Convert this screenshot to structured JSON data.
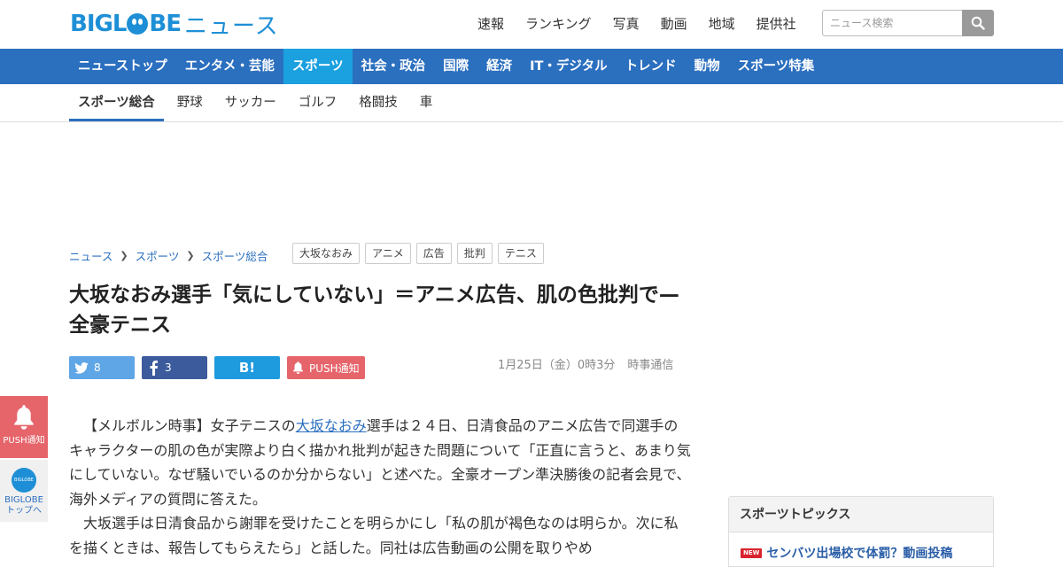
{
  "header": {
    "logo_brand": "BIGL",
    "logo_brand_end": "BE",
    "logo_news": "ニュース",
    "top_links": [
      "速報",
      "ランキング",
      "写真",
      "動画",
      "地域",
      "提供社"
    ],
    "search_placeholder": "ニュース検索"
  },
  "nav": {
    "items": [
      "ニューストップ",
      "エンタメ・芸能",
      "スポーツ",
      "社会・政治",
      "国際",
      "経済",
      "IT・デジタル",
      "トレンド",
      "動物",
      "スポーツ特集"
    ],
    "active_index": 2
  },
  "subnav": {
    "items": [
      "スポーツ総合",
      "野球",
      "サッカー",
      "ゴルフ",
      "格闘技",
      "車"
    ],
    "active_index": 0
  },
  "breadcrumb": [
    "ニュース",
    "スポーツ",
    "スポーツ総合"
  ],
  "tags": [
    "大坂なおみ",
    "アニメ",
    "広告",
    "批判",
    "テニス"
  ],
  "article": {
    "title": "大坂なおみ選手「気にしていない」＝アニメ広告、肌の色批判で—全豪テニス",
    "date": "1月25日（金）0時3分",
    "source": "時事通信",
    "para1_pre": "【メルボルン時事】女子テニスの",
    "para1_link": "大坂なおみ",
    "para1_post": "選手は２４日、日清食品のアニメ広告で同選手のキャラクターの肌の色が実際より白く描かれ批判が起きた問題について「正直に言うと、あまり気にしていない。なぜ騒いでいるのか分からない」と述べた。全豪オープン準決勝後の記者会見で、海外メディアの質問に答えた。",
    "para2": "大坂選手は日清食品から謝罪を受けたことを明らかにし「私の肌が褐色なのは明らか。次に私を描くときは、報告してもらえたら」と話した。同社は広告動画の公開を取りやめ"
  },
  "share": {
    "twitter_count": "8",
    "facebook_count": "3",
    "hatena_label": "B!",
    "push_label": "PUSH通知"
  },
  "side": {
    "push_label": "PUSH通知",
    "biglobe_badge": "BIGLOBE",
    "top_label_1": "BIGLOBE",
    "top_label_2": "トップへ"
  },
  "topics": {
    "heading": "スポーツトピックス",
    "new_badge": "NEW",
    "first_item": "センバツ出場校で体罰？動画投稿"
  },
  "colors": {
    "brand_blue": "#1e8fd6",
    "nav_blue": "#2b6fbf",
    "nav_active": "#1ba0e0",
    "push_red": "#e5656b"
  }
}
